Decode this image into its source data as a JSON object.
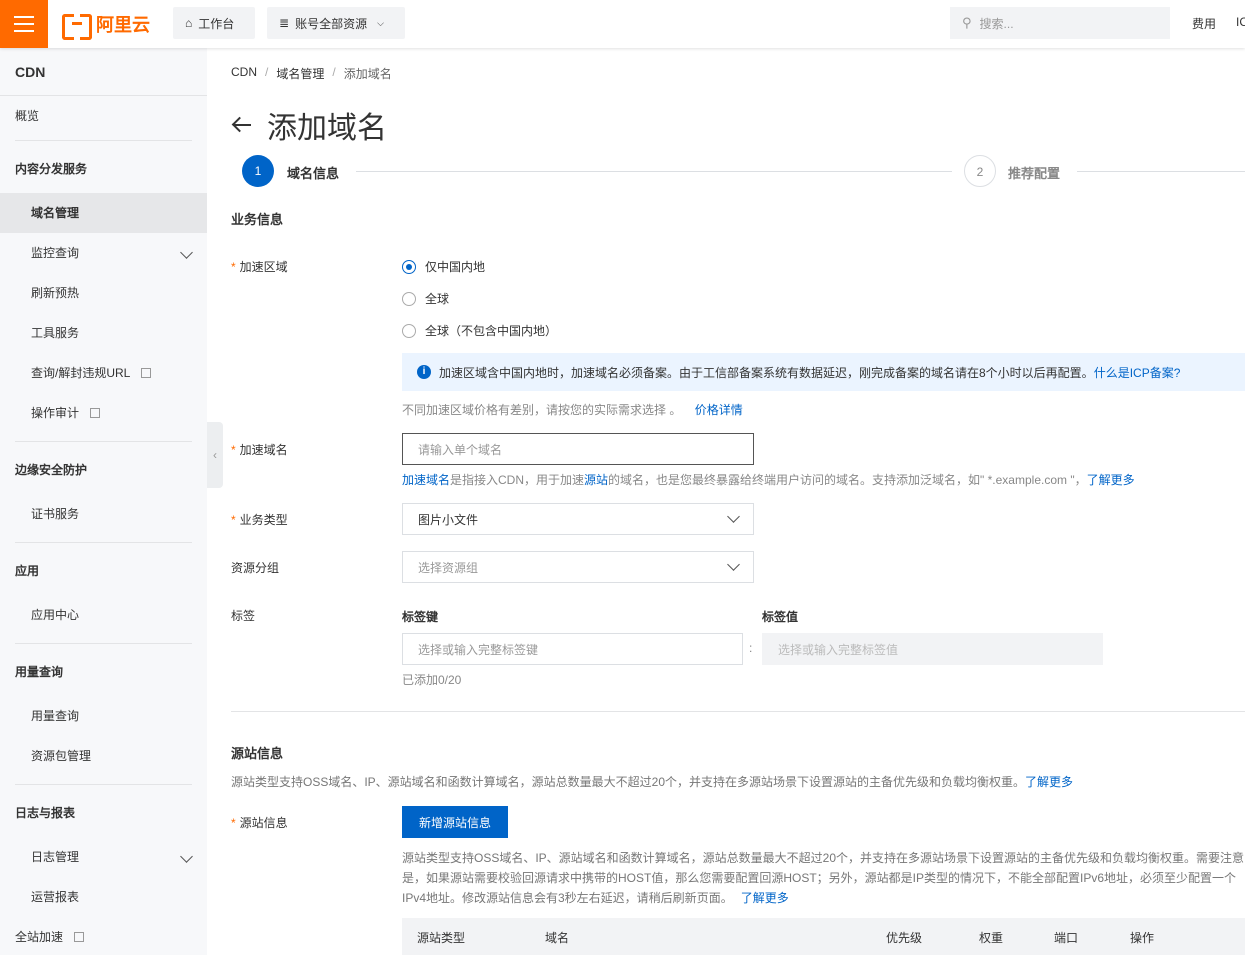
{
  "topbar": {
    "logo_text": "阿里云",
    "workbench": "工作台",
    "resources": "账号全部资源",
    "search_placeholder": "搜索...",
    "fees": "费用",
    "ic_cut": "IC",
    "accent_color": "#ff6a00"
  },
  "sidebar": {
    "title": "CDN",
    "overview": "概览",
    "groups": {
      "content": "内容分发服务",
      "security": "边缘安全防护",
      "apps": "应用",
      "usage": "用量查询",
      "logs": "日志与报表"
    },
    "items": {
      "domain_mgmt": "域名管理",
      "monitor": "监控查询",
      "refresh": "刷新预热",
      "tools": "工具服务",
      "url_block": "查询/解封违规URL",
      "audit": "操作审计",
      "cert": "证书服务",
      "app_center": "应用中心",
      "usage_query": "用量查询",
      "package_mgmt": "资源包管理",
      "log_mgmt": "日志管理",
      "ops_report": "运营报表",
      "full_accel": "全站加速"
    }
  },
  "breadcrumb": [
    "CDN",
    "域名管理",
    "添加域名"
  ],
  "page_title": "添加域名",
  "steps": [
    {
      "number": "1",
      "label": "域名信息",
      "active": true
    },
    {
      "number": "2",
      "label": "推荐配置",
      "active": false
    }
  ],
  "business": {
    "section_title": "业务信息",
    "region_label": "加速区域",
    "region_options": [
      "仅中国内地",
      "全球",
      "全球（不包含中国内地）"
    ],
    "region_selected": "仅中国内地",
    "notice_text": "加速区域含中国内地时，加速域名必须备案。由于工信部备案系统有数据延迟，刚完成备案的域名请在8个小时以后再配置。",
    "notice_link": "什么是ICP备案?",
    "price_hint": "不同加速区域价格有差别，请按您的实际需求选择 。",
    "price_link": "价格详情",
    "domain_label": "加速域名",
    "domain_placeholder": "请输入单个域名",
    "domain_hint_link1": "加速域名",
    "domain_hint_text1": "是指接入CDN，用于加速",
    "domain_hint_link2": "源站",
    "domain_hint_text2": "的域名，也是您最终暴露给终端用户访问的域名。支持添加泛域名，如\" *.example.com \"，",
    "domain_hint_link3": "了解更多",
    "biz_type_label": "业务类型",
    "biz_type_value": "图片小文件",
    "resource_group_label": "资源分组",
    "resource_group_placeholder": "选择资源组",
    "tag_label": "标签",
    "tag_key_label": "标签键",
    "tag_value_label": "标签值",
    "tag_key_placeholder": "选择或输入完整标签键",
    "tag_value_placeholder": "选择或输入完整标签值",
    "tag_colon": ":",
    "tag_count": "已添加0/20"
  },
  "origin": {
    "section_title": "源站信息",
    "section_desc": "源站类型支持OSS域名、IP、源站域名和函数计算域名，源站总数量最大不超过20个，并支持在多源站场景下设置源站的主备优先级和负载均衡权重。",
    "section_link": "了解更多",
    "origin_label": "源站信息",
    "add_button": "新增源站信息",
    "desc_line1": "源站类型支持OSS域名、IP、源站域名和函数计算域名，源站总数量最大不超过20个，并支持在多源站场景下设置源站的主备优先级和负载均衡权重。需要注意的",
    "desc_line2": "是，如果源站需要校验回源请求中携带的HOST值，那么您需要配置回源HOST；另外，源站都是IP类型的情况下，不能全部配置IPv6地址，必须至少配置一个",
    "desc_line3": "IPv4地址。修改源站信息会有3秒左右延迟，请稍后刷新页面。",
    "desc_link": "了解更多",
    "table_columns": [
      "源站类型",
      "域名",
      "优先级",
      "权重",
      "端口",
      "操作"
    ]
  }
}
